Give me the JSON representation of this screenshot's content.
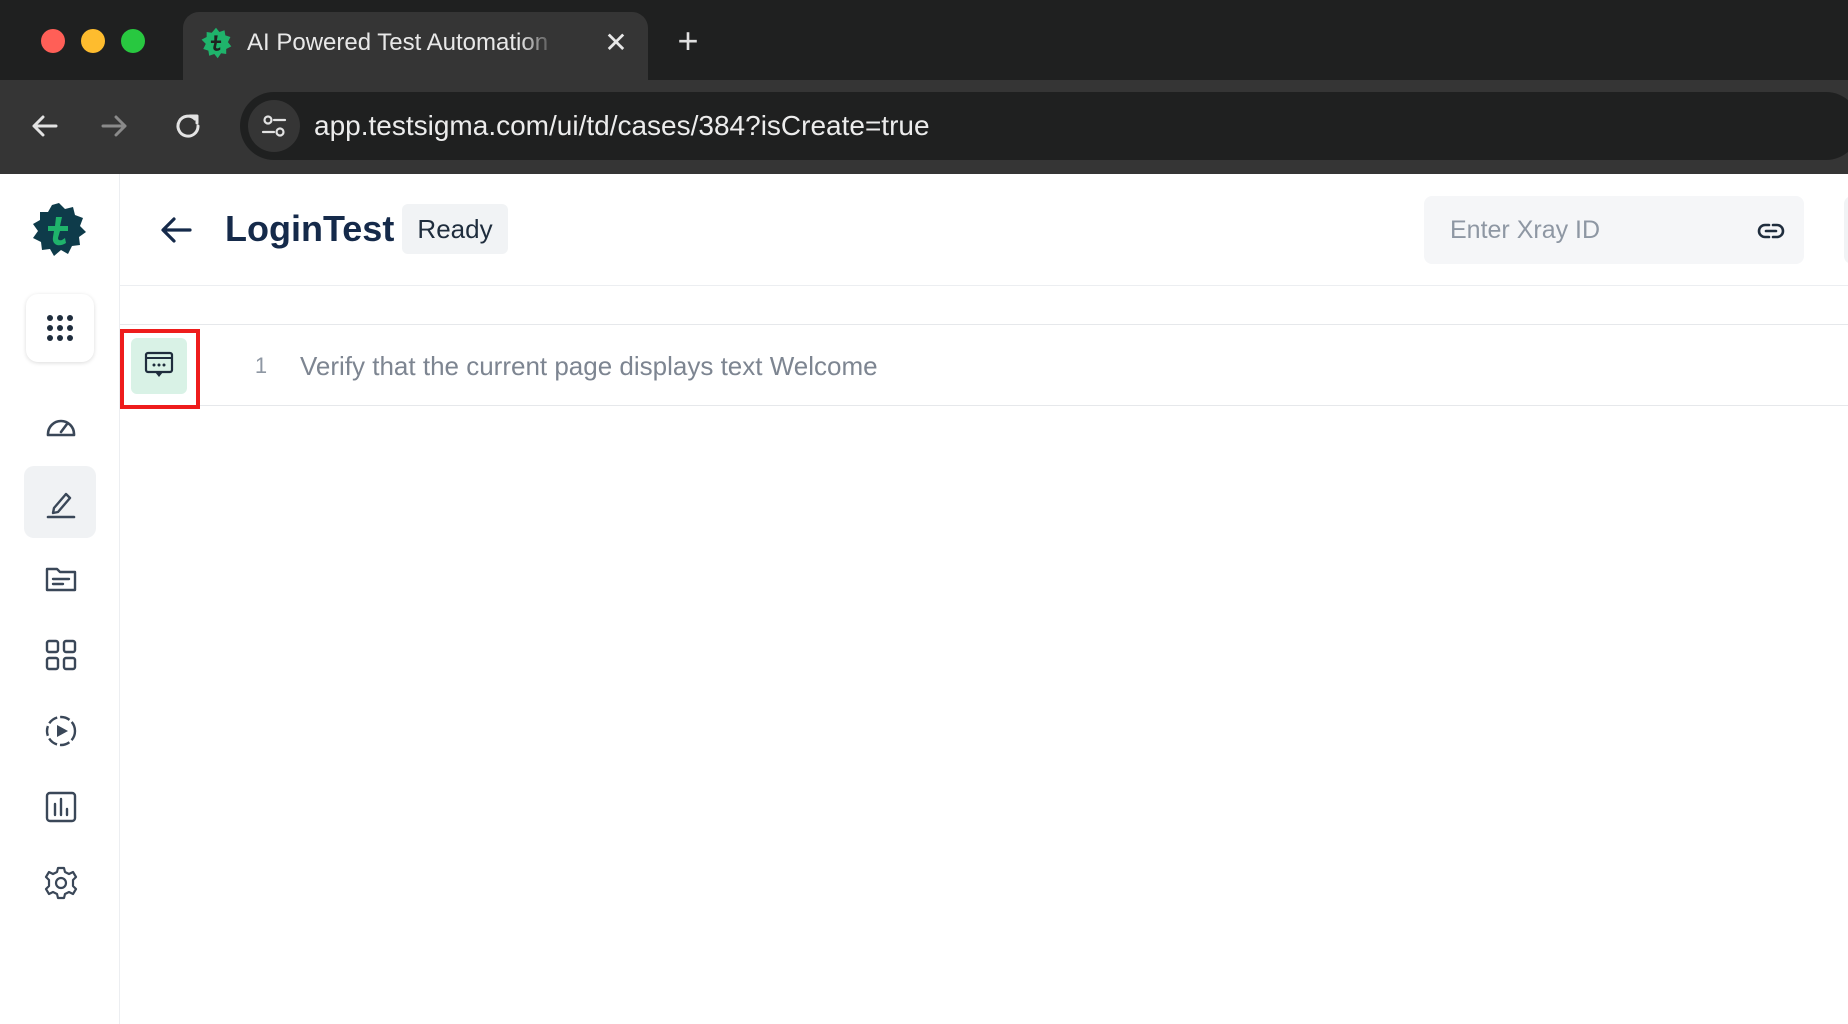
{
  "browser": {
    "tab_title": "AI Powered Test Automation",
    "tab_close": "✕",
    "new_tab": "+",
    "url": "app.testsigma.com/ui/td/cases/384?isCreate=true"
  },
  "colors": {
    "brand_dark": "#0e3b4a",
    "brand_green": "#1fb36b",
    "highlight_red": "#ee1c1c",
    "step_icon_bg": "#d9f2e6"
  },
  "sidebar": {
    "items": [
      {
        "icon": "dashboard-icon",
        "active": false
      },
      {
        "icon": "edit-icon",
        "active": true
      },
      {
        "icon": "folder-icon",
        "active": false
      },
      {
        "icon": "grid-icon",
        "active": false
      },
      {
        "icon": "run-icon",
        "active": false
      },
      {
        "icon": "reports-icon",
        "active": false
      },
      {
        "icon": "settings-icon",
        "active": false
      }
    ]
  },
  "header": {
    "title": "LoginTest",
    "status": "Ready",
    "xray_placeholder": "Enter Xray ID"
  },
  "steps": [
    {
      "number": "1",
      "text": "Verify that the current page displays text Welcome",
      "icon": "message-step-icon"
    }
  ]
}
